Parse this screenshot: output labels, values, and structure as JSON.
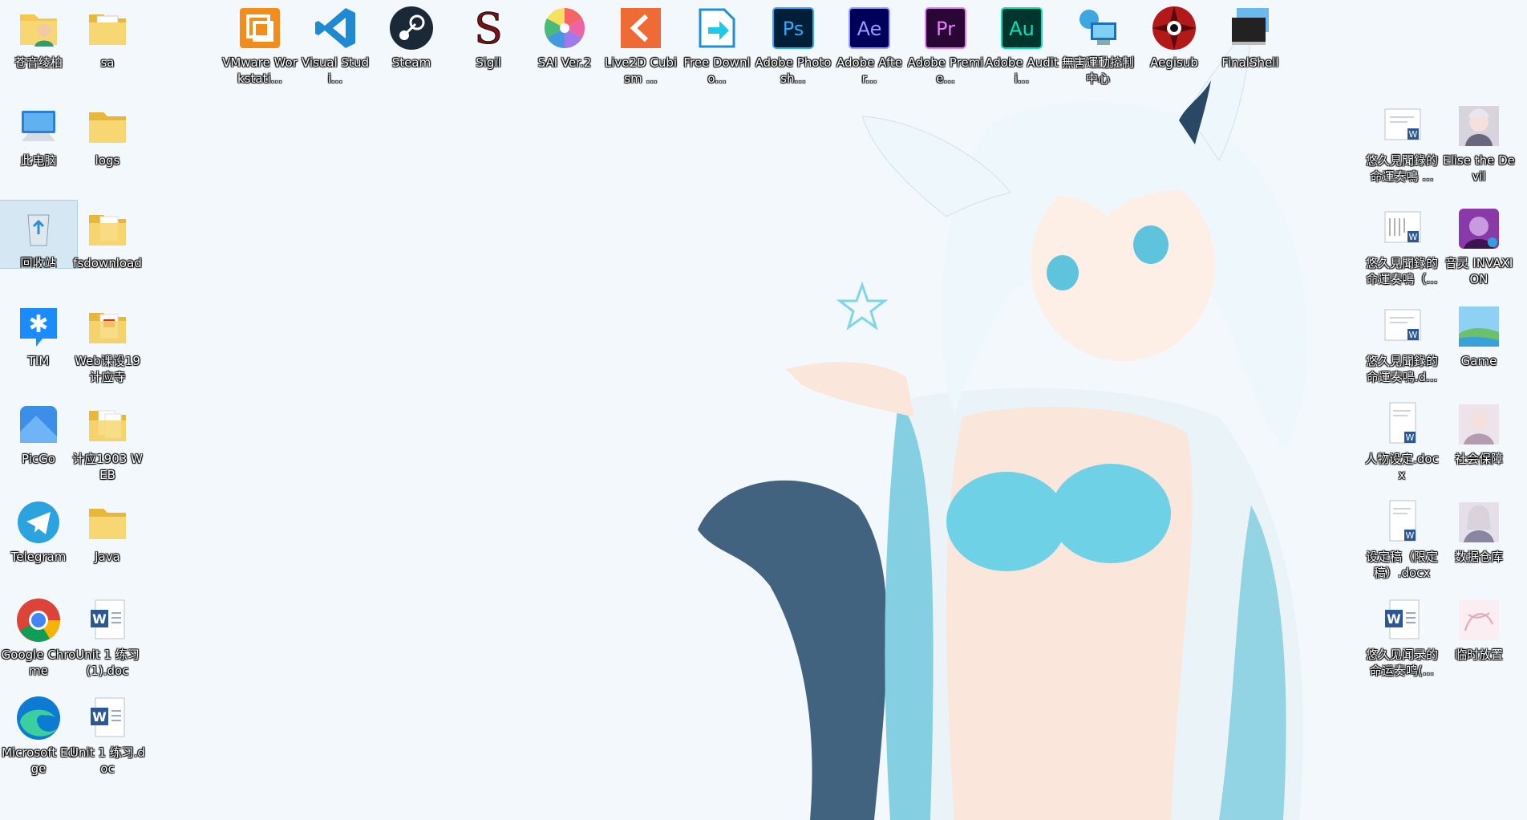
{
  "desktop": {
    "left_icons": [
      {
        "label": "苍音绫柏",
        "icon": "user-folder-icon"
      },
      {
        "label": "sa",
        "icon": "folder-icon"
      },
      {
        "label": "此电脑",
        "icon": "computer-icon"
      },
      {
        "label": "logs",
        "icon": "folder-icon"
      },
      {
        "label": "回收站",
        "icon": "recycle-bin-icon"
      },
      {
        "label": "fsdownload",
        "icon": "folder-icon"
      },
      {
        "label": "TIM",
        "icon": "tim-icon"
      },
      {
        "label": "Web课设19计应寺",
        "icon": "folder-pdf-icon"
      },
      {
        "label": "PicGo",
        "icon": "picgo-icon"
      },
      {
        "label": "计应1903 WEB",
        "icon": "folder-docs-icon"
      },
      {
        "label": "Telegram",
        "icon": "telegram-icon"
      },
      {
        "label": "Java",
        "icon": "folder-icon"
      },
      {
        "label": "Google Chrome",
        "icon": "chrome-icon"
      },
      {
        "label": "Unit 1 练习 (1).doc",
        "icon": "word-doc-icon"
      },
      {
        "label": "Microsoft Edge",
        "icon": "edge-icon"
      },
      {
        "label": "Unit 1 练习.doc",
        "icon": "word-doc-icon"
      }
    ],
    "top_icons": [
      {
        "label": "VMware Workstati...",
        "icon": "vmware-icon"
      },
      {
        "label": "Visual Studi...",
        "icon": "vscode-icon"
      },
      {
        "label": "Steam",
        "icon": "steam-icon"
      },
      {
        "label": "Sigil",
        "icon": "sigil-icon"
      },
      {
        "label": "SAI Ver.2",
        "icon": "sai-icon"
      },
      {
        "label": "Live2D Cubism ...",
        "icon": "live2d-icon"
      },
      {
        "label": "Free Downlo...",
        "icon": "fdm-icon"
      },
      {
        "label": "Adobe Photosh...",
        "icon": "photoshop-icon"
      },
      {
        "label": "Adobe After...",
        "icon": "after-effects-icon"
      },
      {
        "label": "Adobe Premie...",
        "icon": "premiere-icon"
      },
      {
        "label": "Adobe Auditi...",
        "icon": "audition-icon"
      },
      {
        "label": "無害運動控制中心",
        "icon": "network-icon"
      },
      {
        "label": "Aegisub",
        "icon": "aegisub-icon"
      },
      {
        "label": "FinalShell",
        "icon": "finalshell-icon"
      }
    ],
    "right_icons": [
      {
        "label": "悠久見聞錄的命運奏鳴 ...",
        "icon": "word-doc-icon"
      },
      {
        "label": "Elise the Devil",
        "icon": "anime-image-icon"
      },
      {
        "label": "悠久見聞錄的命運奏鳴（...",
        "icon": "word-doc-icon"
      },
      {
        "label": "音灵 INVAXION",
        "icon": "invaxion-icon"
      },
      {
        "label": "悠久見聞錄的命運奏鳴.d...",
        "icon": "word-doc-icon"
      },
      {
        "label": "Game",
        "icon": "landscape-image-icon"
      },
      {
        "label": "人物设定.docx",
        "icon": "word-doc-icon"
      },
      {
        "label": "社会保障",
        "icon": "anime-image-icon"
      },
      {
        "label": "设定稿（限定稿）.docx",
        "icon": "word-doc-icon"
      },
      {
        "label": "数据仓库",
        "icon": "anime-image-icon"
      },
      {
        "label": "悠久见闻录的命运奏鸣(...",
        "icon": "word-doc-icon"
      },
      {
        "label": "临时放置",
        "icon": "sketch-image-icon"
      }
    ],
    "colors": {
      "background": "#f3f8fc",
      "label_text": "#ffffff",
      "selection": "#b4d2eb"
    }
  }
}
